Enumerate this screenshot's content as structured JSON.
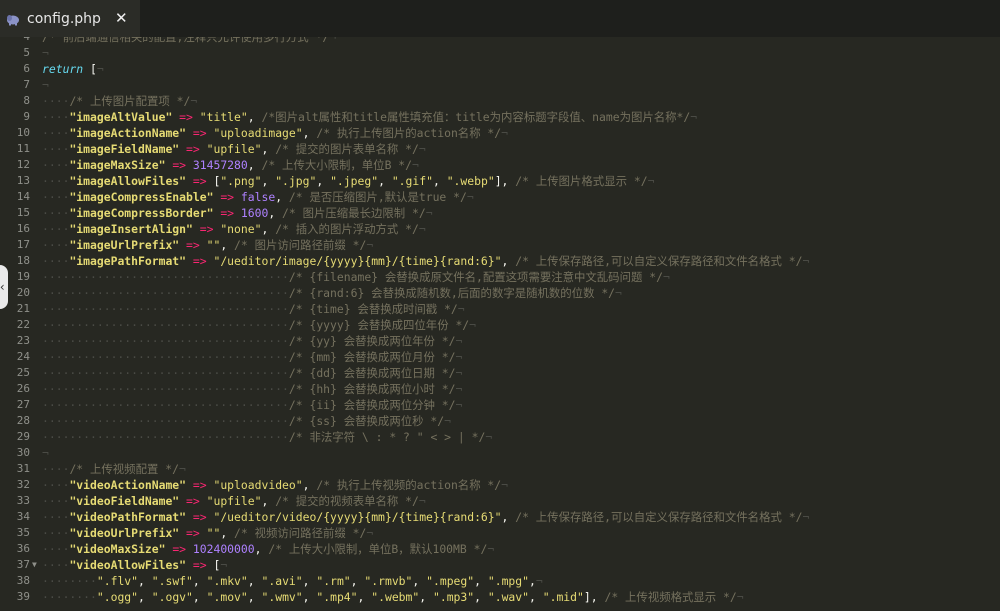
{
  "tab": {
    "title": "config.php",
    "close": "✕",
    "icon": "php-elephant-icon"
  },
  "side_handle": {
    "glyph": "‹",
    "icon": "chevron-left-icon"
  },
  "colors": {
    "background": "#272822",
    "comment": "#75715e",
    "string": "#e6db74",
    "operator": "#f92672",
    "number": "#ae81ff",
    "keyword": "#66d9ef"
  },
  "lines": [
    {
      "n": "4",
      "t": [
        [
          "cmt",
          "/* 前后端通信相关的配置,注释只允许使用多行方式 */"
        ],
        [
          "ws",
          "¬"
        ]
      ]
    },
    {
      "n": "5",
      "t": [
        [
          "ws",
          "¬"
        ]
      ]
    },
    {
      "n": "6",
      "t": [
        [
          "kw",
          "return"
        ],
        [
          "txt",
          " ["
        ],
        [
          "ws",
          "¬"
        ]
      ]
    },
    {
      "n": "7",
      "t": [
        [
          "ws",
          "¬"
        ]
      ]
    },
    {
      "n": "8",
      "t": [
        [
          "ws",
          "····"
        ],
        [
          "cmt",
          "/* 上传图片配置项 */"
        ],
        [
          "ws",
          "¬"
        ]
      ]
    },
    {
      "n": "9",
      "t": [
        [
          "ws",
          "····"
        ],
        [
          "key",
          "\"imageAltValue\""
        ],
        [
          "txt",
          " "
        ],
        [
          "op",
          "=>"
        ],
        [
          "txt",
          " "
        ],
        [
          "str",
          "\"title\""
        ],
        [
          "txt",
          ", "
        ],
        [
          "cmt",
          "/*图片alt属性和title属性填充值：title为内容标题字段值、name为图片名称*/"
        ],
        [
          "ws",
          "¬"
        ]
      ]
    },
    {
      "n": "10",
      "t": [
        [
          "ws",
          "····"
        ],
        [
          "key",
          "\"imageActionName\""
        ],
        [
          "txt",
          " "
        ],
        [
          "op",
          "=>"
        ],
        [
          "txt",
          " "
        ],
        [
          "str",
          "\"uploadimage\""
        ],
        [
          "txt",
          ", "
        ],
        [
          "cmt",
          "/* 执行上传图片的action名称 */"
        ],
        [
          "ws",
          "¬"
        ]
      ]
    },
    {
      "n": "11",
      "t": [
        [
          "ws",
          "····"
        ],
        [
          "key",
          "\"imageFieldName\""
        ],
        [
          "txt",
          " "
        ],
        [
          "op",
          "=>"
        ],
        [
          "txt",
          " "
        ],
        [
          "str",
          "\"upfile\""
        ],
        [
          "txt",
          ", "
        ],
        [
          "cmt",
          "/* 提交的图片表单名称 */"
        ],
        [
          "ws",
          "¬"
        ]
      ]
    },
    {
      "n": "12",
      "t": [
        [
          "ws",
          "····"
        ],
        [
          "key",
          "\"imageMaxSize\""
        ],
        [
          "txt",
          " "
        ],
        [
          "op",
          "=>"
        ],
        [
          "txt",
          " "
        ],
        [
          "num",
          "31457280"
        ],
        [
          "txt",
          ", "
        ],
        [
          "cmt",
          "/* 上传大小限制，单位B */"
        ],
        [
          "ws",
          "¬"
        ]
      ]
    },
    {
      "n": "13",
      "t": [
        [
          "ws",
          "····"
        ],
        [
          "key",
          "\"imageAllowFiles\""
        ],
        [
          "txt",
          " "
        ],
        [
          "op",
          "=>"
        ],
        [
          "txt",
          " ["
        ],
        [
          "str",
          "\".png\""
        ],
        [
          "txt",
          ", "
        ],
        [
          "str",
          "\".jpg\""
        ],
        [
          "txt",
          ", "
        ],
        [
          "str",
          "\".jpeg\""
        ],
        [
          "txt",
          ", "
        ],
        [
          "str",
          "\".gif\""
        ],
        [
          "txt",
          ", "
        ],
        [
          "str",
          "\".webp\""
        ],
        [
          "txt",
          "], "
        ],
        [
          "cmt",
          "/* 上传图片格式显示 */"
        ],
        [
          "ws",
          "¬"
        ]
      ]
    },
    {
      "n": "14",
      "t": [
        [
          "ws",
          "····"
        ],
        [
          "key",
          "\"imageCompressEnable\""
        ],
        [
          "txt",
          " "
        ],
        [
          "op",
          "=>"
        ],
        [
          "txt",
          " "
        ],
        [
          "bool",
          "false"
        ],
        [
          "txt",
          ", "
        ],
        [
          "cmt",
          "/* 是否压缩图片,默认是true */"
        ],
        [
          "ws",
          "¬"
        ]
      ]
    },
    {
      "n": "15",
      "t": [
        [
          "ws",
          "····"
        ],
        [
          "key",
          "\"imageCompressBorder\""
        ],
        [
          "txt",
          " "
        ],
        [
          "op",
          "=>"
        ],
        [
          "txt",
          " "
        ],
        [
          "num",
          "1600"
        ],
        [
          "txt",
          ", "
        ],
        [
          "cmt",
          "/* 图片压缩最长边限制 */"
        ],
        [
          "ws",
          "¬"
        ]
      ]
    },
    {
      "n": "16",
      "t": [
        [
          "ws",
          "····"
        ],
        [
          "key",
          "\"imageInsertAlign\""
        ],
        [
          "txt",
          " "
        ],
        [
          "op",
          "=>"
        ],
        [
          "txt",
          " "
        ],
        [
          "str",
          "\"none\""
        ],
        [
          "txt",
          ", "
        ],
        [
          "cmt",
          "/* 插入的图片浮动方式 */"
        ],
        [
          "ws",
          "¬"
        ]
      ]
    },
    {
      "n": "17",
      "t": [
        [
          "ws",
          "····"
        ],
        [
          "key",
          "\"imageUrlPrefix\""
        ],
        [
          "txt",
          " "
        ],
        [
          "op",
          "=>"
        ],
        [
          "txt",
          " "
        ],
        [
          "str",
          "\"\""
        ],
        [
          "txt",
          ", "
        ],
        [
          "cmt",
          "/* 图片访问路径前缀 */"
        ],
        [
          "ws",
          "¬"
        ]
      ]
    },
    {
      "n": "18",
      "t": [
        [
          "ws",
          "····"
        ],
        [
          "key",
          "\"imagePathFormat\""
        ],
        [
          "txt",
          " "
        ],
        [
          "op",
          "=>"
        ],
        [
          "txt",
          " "
        ],
        [
          "str",
          "\"/ueditor/image/{yyyy}{mm}/{time}{rand:6}\""
        ],
        [
          "txt",
          ", "
        ],
        [
          "cmt",
          "/* 上传保存路径,可以自定义保存路径和文件名格式 */"
        ],
        [
          "ws",
          "¬"
        ]
      ]
    },
    {
      "n": "19",
      "t": [
        [
          "ws",
          "····································"
        ],
        [
          "cmt",
          "/* {filename} 会替换成原文件名,配置这项需要注意中文乱码问题 */"
        ],
        [
          "ws",
          "¬"
        ]
      ]
    },
    {
      "n": "20",
      "t": [
        [
          "ws",
          "····································"
        ],
        [
          "cmt",
          "/* {rand:6} 会替换成随机数,后面的数字是随机数的位数 */"
        ],
        [
          "ws",
          "¬"
        ]
      ]
    },
    {
      "n": "21",
      "t": [
        [
          "ws",
          "····································"
        ],
        [
          "cmt",
          "/* {time} 会替换成时间戳 */"
        ],
        [
          "ws",
          "¬"
        ]
      ]
    },
    {
      "n": "22",
      "t": [
        [
          "ws",
          "····································"
        ],
        [
          "cmt",
          "/* {yyyy} 会替换成四位年份 */"
        ],
        [
          "ws",
          "¬"
        ]
      ]
    },
    {
      "n": "23",
      "t": [
        [
          "ws",
          "····································"
        ],
        [
          "cmt",
          "/* {yy} 会替换成两位年份 */"
        ],
        [
          "ws",
          "¬"
        ]
      ]
    },
    {
      "n": "24",
      "t": [
        [
          "ws",
          "····································"
        ],
        [
          "cmt",
          "/* {mm} 会替换成两位月份 */"
        ],
        [
          "ws",
          "¬"
        ]
      ]
    },
    {
      "n": "25",
      "t": [
        [
          "ws",
          "····································"
        ],
        [
          "cmt",
          "/* {dd} 会替换成两位日期 */"
        ],
        [
          "ws",
          "¬"
        ]
      ]
    },
    {
      "n": "26",
      "t": [
        [
          "ws",
          "····································"
        ],
        [
          "cmt",
          "/* {hh} 会替换成两位小时 */"
        ],
        [
          "ws",
          "¬"
        ]
      ]
    },
    {
      "n": "27",
      "t": [
        [
          "ws",
          "····································"
        ],
        [
          "cmt",
          "/* {ii} 会替换成两位分钟 */"
        ],
        [
          "ws",
          "¬"
        ]
      ]
    },
    {
      "n": "28",
      "t": [
        [
          "ws",
          "····································"
        ],
        [
          "cmt",
          "/* {ss} 会替换成两位秒 */"
        ],
        [
          "ws",
          "¬"
        ]
      ]
    },
    {
      "n": "29",
      "t": [
        [
          "ws",
          "····································"
        ],
        [
          "cmt",
          "/* 非法字符 \\ : * ? \" < > | */"
        ],
        [
          "ws",
          "¬"
        ]
      ]
    },
    {
      "n": "30",
      "t": [
        [
          "ws",
          "¬"
        ]
      ]
    },
    {
      "n": "31",
      "t": [
        [
          "ws",
          "····"
        ],
        [
          "cmt",
          "/* 上传视频配置 */"
        ],
        [
          "ws",
          "¬"
        ]
      ]
    },
    {
      "n": "32",
      "t": [
        [
          "ws",
          "····"
        ],
        [
          "key",
          "\"videoActionName\""
        ],
        [
          "txt",
          " "
        ],
        [
          "op",
          "=>"
        ],
        [
          "txt",
          " "
        ],
        [
          "str",
          "\"uploadvideo\""
        ],
        [
          "txt",
          ", "
        ],
        [
          "cmt",
          "/* 执行上传视频的action名称 */"
        ],
        [
          "ws",
          "¬"
        ]
      ]
    },
    {
      "n": "33",
      "t": [
        [
          "ws",
          "····"
        ],
        [
          "key",
          "\"videoFieldName\""
        ],
        [
          "txt",
          " "
        ],
        [
          "op",
          "=>"
        ],
        [
          "txt",
          " "
        ],
        [
          "str",
          "\"upfile\""
        ],
        [
          "txt",
          ", "
        ],
        [
          "cmt",
          "/* 提交的视频表单名称 */"
        ],
        [
          "ws",
          "¬"
        ]
      ]
    },
    {
      "n": "34",
      "t": [
        [
          "ws",
          "····"
        ],
        [
          "key",
          "\"videoPathFormat\""
        ],
        [
          "txt",
          " "
        ],
        [
          "op",
          "=>"
        ],
        [
          "txt",
          " "
        ],
        [
          "str",
          "\"/ueditor/video/{yyyy}{mm}/{time}{rand:6}\""
        ],
        [
          "txt",
          ", "
        ],
        [
          "cmt",
          "/* 上传保存路径,可以自定义保存路径和文件名格式 */"
        ],
        [
          "ws",
          "¬"
        ]
      ]
    },
    {
      "n": "35",
      "t": [
        [
          "ws",
          "····"
        ],
        [
          "key",
          "\"videoUrlPrefix\""
        ],
        [
          "txt",
          " "
        ],
        [
          "op",
          "=>"
        ],
        [
          "txt",
          " "
        ],
        [
          "str",
          "\"\""
        ],
        [
          "txt",
          ", "
        ],
        [
          "cmt",
          "/* 视频访问路径前缀 */"
        ],
        [
          "ws",
          "¬"
        ]
      ]
    },
    {
      "n": "36",
      "t": [
        [
          "ws",
          "····"
        ],
        [
          "key",
          "\"videoMaxSize\""
        ],
        [
          "txt",
          " "
        ],
        [
          "op",
          "=>"
        ],
        [
          "txt",
          " "
        ],
        [
          "num",
          "102400000"
        ],
        [
          "txt",
          ", "
        ],
        [
          "cmt",
          "/* 上传大小限制，单位B，默认100MB */"
        ],
        [
          "ws",
          "¬"
        ]
      ]
    },
    {
      "n": "37",
      "fold": true,
      "t": [
        [
          "ws",
          "····"
        ],
        [
          "key",
          "\"videoAllowFiles\""
        ],
        [
          "txt",
          " "
        ],
        [
          "op",
          "=>"
        ],
        [
          "txt",
          " ["
        ],
        [
          "ws",
          "¬"
        ]
      ]
    },
    {
      "n": "38",
      "t": [
        [
          "ws",
          "········"
        ],
        [
          "str",
          "\".flv\""
        ],
        [
          "txt",
          ", "
        ],
        [
          "str",
          "\".swf\""
        ],
        [
          "txt",
          ", "
        ],
        [
          "str",
          "\".mkv\""
        ],
        [
          "txt",
          ", "
        ],
        [
          "str",
          "\".avi\""
        ],
        [
          "txt",
          ", "
        ],
        [
          "str",
          "\".rm\""
        ],
        [
          "txt",
          ", "
        ],
        [
          "str",
          "\".rmvb\""
        ],
        [
          "txt",
          ", "
        ],
        [
          "str",
          "\".mpeg\""
        ],
        [
          "txt",
          ", "
        ],
        [
          "str",
          "\".mpg\""
        ],
        [
          "txt",
          ","
        ],
        [
          "ws",
          "¬"
        ]
      ]
    },
    {
      "n": "39",
      "t": [
        [
          "ws",
          "········"
        ],
        [
          "str",
          "\".ogg\""
        ],
        [
          "txt",
          ", "
        ],
        [
          "str",
          "\".ogv\""
        ],
        [
          "txt",
          ", "
        ],
        [
          "str",
          "\".mov\""
        ],
        [
          "txt",
          ", "
        ],
        [
          "str",
          "\".wmv\""
        ],
        [
          "txt",
          ", "
        ],
        [
          "str",
          "\".mp4\""
        ],
        [
          "txt",
          ", "
        ],
        [
          "str",
          "\".webm\""
        ],
        [
          "txt",
          ", "
        ],
        [
          "str",
          "\".mp3\""
        ],
        [
          "txt",
          ", "
        ],
        [
          "str",
          "\".wav\""
        ],
        [
          "txt",
          ", "
        ],
        [
          "str",
          "\".mid\""
        ],
        [
          "txt",
          "], "
        ],
        [
          "cmt",
          "/* 上传视频格式显示 */"
        ],
        [
          "ws",
          "¬"
        ]
      ]
    }
  ]
}
